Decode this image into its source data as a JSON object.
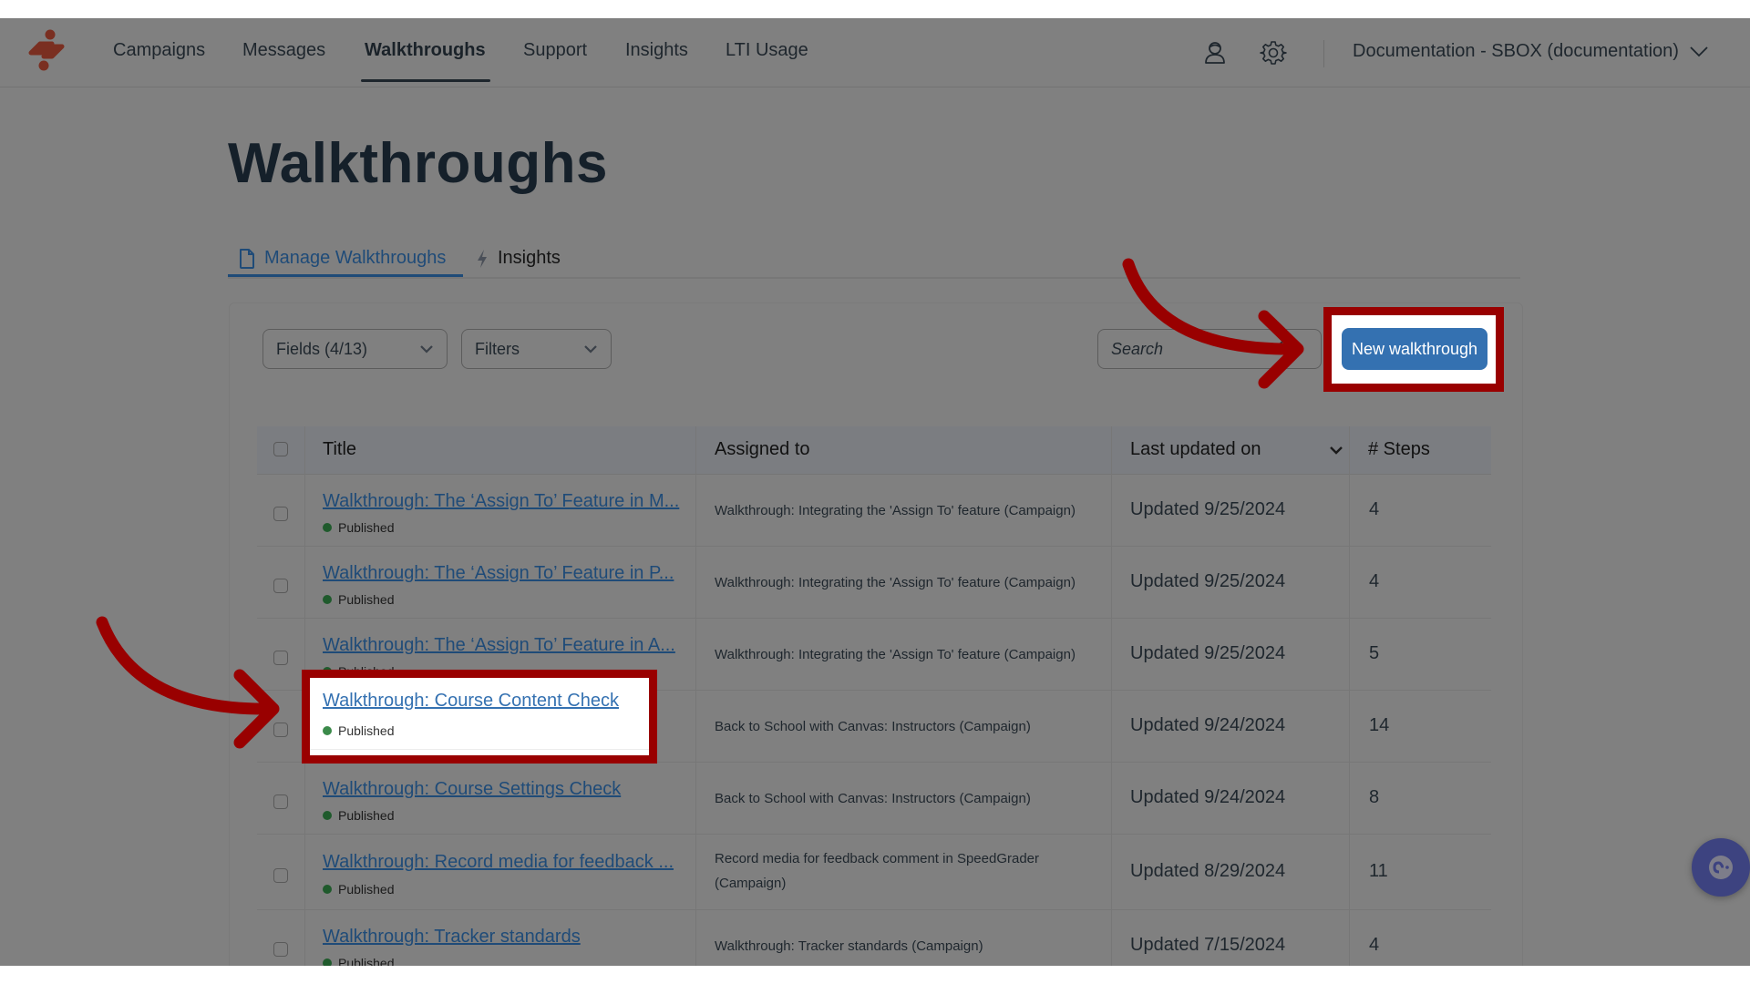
{
  "nav": {
    "logo": "brand-logo",
    "items": [
      {
        "label": "Campaigns",
        "active": false
      },
      {
        "label": "Messages",
        "active": false
      },
      {
        "label": "Walkthroughs",
        "active": true
      },
      {
        "label": "Support",
        "active": false
      },
      {
        "label": "Insights",
        "active": false
      },
      {
        "label": "LTI Usage",
        "active": false
      }
    ],
    "icons": [
      "user-icon",
      "gear-icon"
    ],
    "account_label": "Documentation - SBOX (documentation)"
  },
  "page": {
    "title": "Walkthroughs",
    "tabs": [
      {
        "label": "Manage Walkthroughs",
        "icon": "document-icon",
        "active": true
      },
      {
        "label": "Insights",
        "icon": "lightning-icon",
        "active": false
      }
    ]
  },
  "toolbar": {
    "fields_label": "Fields (4/13)",
    "filters_label": "Filters",
    "search_placeholder": "Search",
    "search_value": "",
    "new_button_label": "New walkthrough"
  },
  "table": {
    "columns": [
      "Title",
      "Assigned to",
      "Last updated on",
      "# Steps"
    ],
    "sort_column": "Last updated on",
    "rows": [
      {
        "title": "Walkthrough: The ‘Assign To’ Feature in M...",
        "status": "Published",
        "assigned": "Walkthrough: Integrating the 'Assign To' feature (Campaign)",
        "updated": "Updated 9/25/2024",
        "steps": "4"
      },
      {
        "title": "Walkthrough: The ‘Assign To’ Feature in P...",
        "status": "Published",
        "assigned": "Walkthrough: Integrating the 'Assign To' feature (Campaign)",
        "updated": "Updated 9/25/2024",
        "steps": "4"
      },
      {
        "title": "Walkthrough: The ‘Assign To’ Feature in A...",
        "status": "Published",
        "assigned": "Walkthrough: Integrating the 'Assign To' feature (Campaign)",
        "updated": "Updated 9/25/2024",
        "steps": "5"
      },
      {
        "title": "Walkthrough: Course Content Check",
        "status": "Published",
        "assigned": "Back to School with Canvas: Instructors (Campaign)",
        "updated": "Updated 9/24/2024",
        "steps": "14"
      },
      {
        "title": "Walkthrough: Course Settings Check",
        "status": "Published",
        "assigned": "Back to School with Canvas: Instructors (Campaign)",
        "updated": "Updated 9/24/2024",
        "steps": "8"
      },
      {
        "title": "Walkthrough: Record media for feedback ...",
        "status": "Published",
        "assigned": "Record media for feedback comment in SpeedGrader (Campaign)",
        "updated": "Updated 8/29/2024",
        "steps": "11"
      },
      {
        "title": "Walkthrough: Tracker standards",
        "status": "Published",
        "assigned": "Walkthrough: Tracker standards (Campaign)",
        "updated": "Updated 7/15/2024",
        "steps": "4"
      }
    ]
  },
  "annotations": {
    "color": "#990000",
    "highlights": [
      "new-walkthrough-button",
      "course-content-check-title"
    ]
  },
  "help_button": {
    "icon": "help-icon"
  },
  "colors": {
    "brand": "#9e3a26",
    "primary_button": "#3471b1",
    "link": "#3471b1",
    "published": "#3b8a4a"
  }
}
